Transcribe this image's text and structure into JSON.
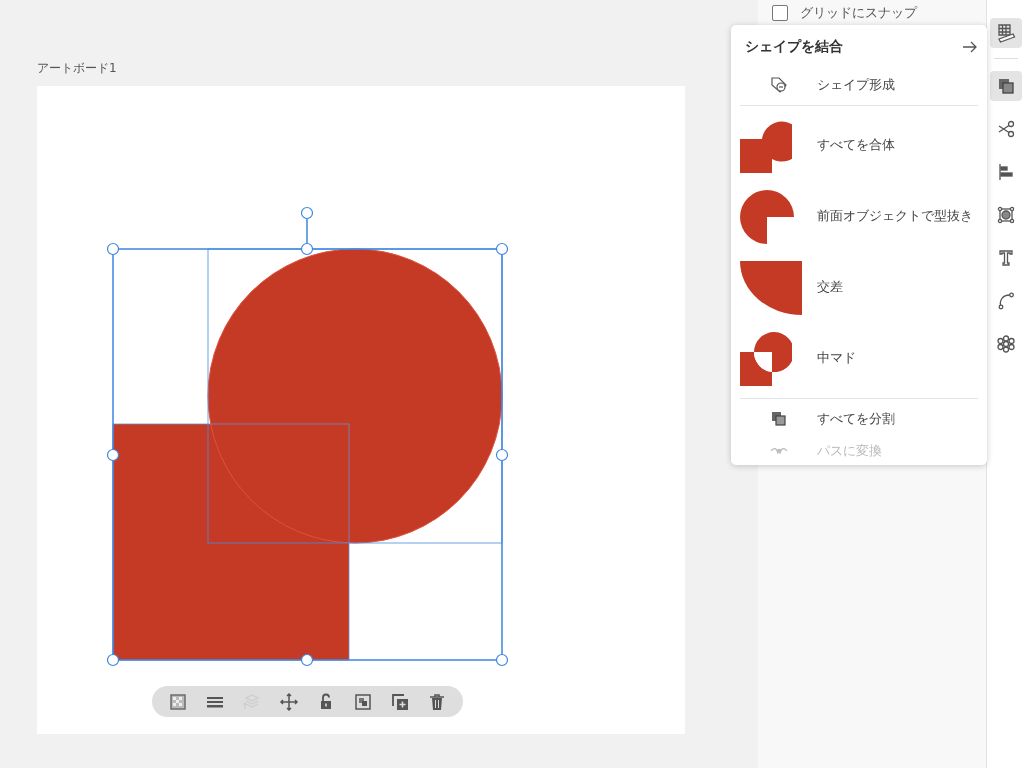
{
  "artboard": {
    "label": "アートボード1"
  },
  "canvas_toolbar": [
    {
      "kind": "fill",
      "disabled": false
    },
    {
      "kind": "stroke",
      "disabled": false
    },
    {
      "kind": "arrange",
      "disabled": true
    },
    {
      "kind": "move",
      "disabled": false
    },
    {
      "kind": "lock",
      "disabled": false
    },
    {
      "kind": "duplicate",
      "disabled": false
    },
    {
      "kind": "add",
      "disabled": false
    },
    {
      "kind": "delete",
      "disabled": false
    }
  ],
  "panel": {
    "snap_option": {
      "label": "グリッドにスナップ",
      "checked": false
    }
  },
  "popover": {
    "title": "シェイプを結合",
    "sections": [
      [
        {
          "kind": "shape-builder",
          "label": "シェイプ形成",
          "disabled": false
        }
      ],
      [
        {
          "kind": "union",
          "label": "すべてを合体",
          "disabled": false
        },
        {
          "kind": "minus-front",
          "label": "前面オブジェクトで型抜き",
          "disabled": false
        },
        {
          "kind": "intersect",
          "label": "交差",
          "disabled": false
        },
        {
          "kind": "exclude",
          "label": "中マド",
          "disabled": false
        }
      ],
      [
        {
          "kind": "divide",
          "label": "すべてを分割",
          "disabled": false
        },
        {
          "kind": "convert-path",
          "label": "パスに変換",
          "disabled": true
        }
      ]
    ]
  },
  "right_toolbar": [
    {
      "kind": "grid",
      "selected": true
    },
    {
      "kind": "combine",
      "selected": true
    },
    {
      "kind": "cut",
      "selected": false
    },
    {
      "kind": "align",
      "selected": false
    },
    {
      "kind": "mask",
      "selected": false
    },
    {
      "kind": "text",
      "selected": false
    },
    {
      "kind": "path",
      "selected": false
    },
    {
      "kind": "pattern",
      "selected": false
    }
  ]
}
